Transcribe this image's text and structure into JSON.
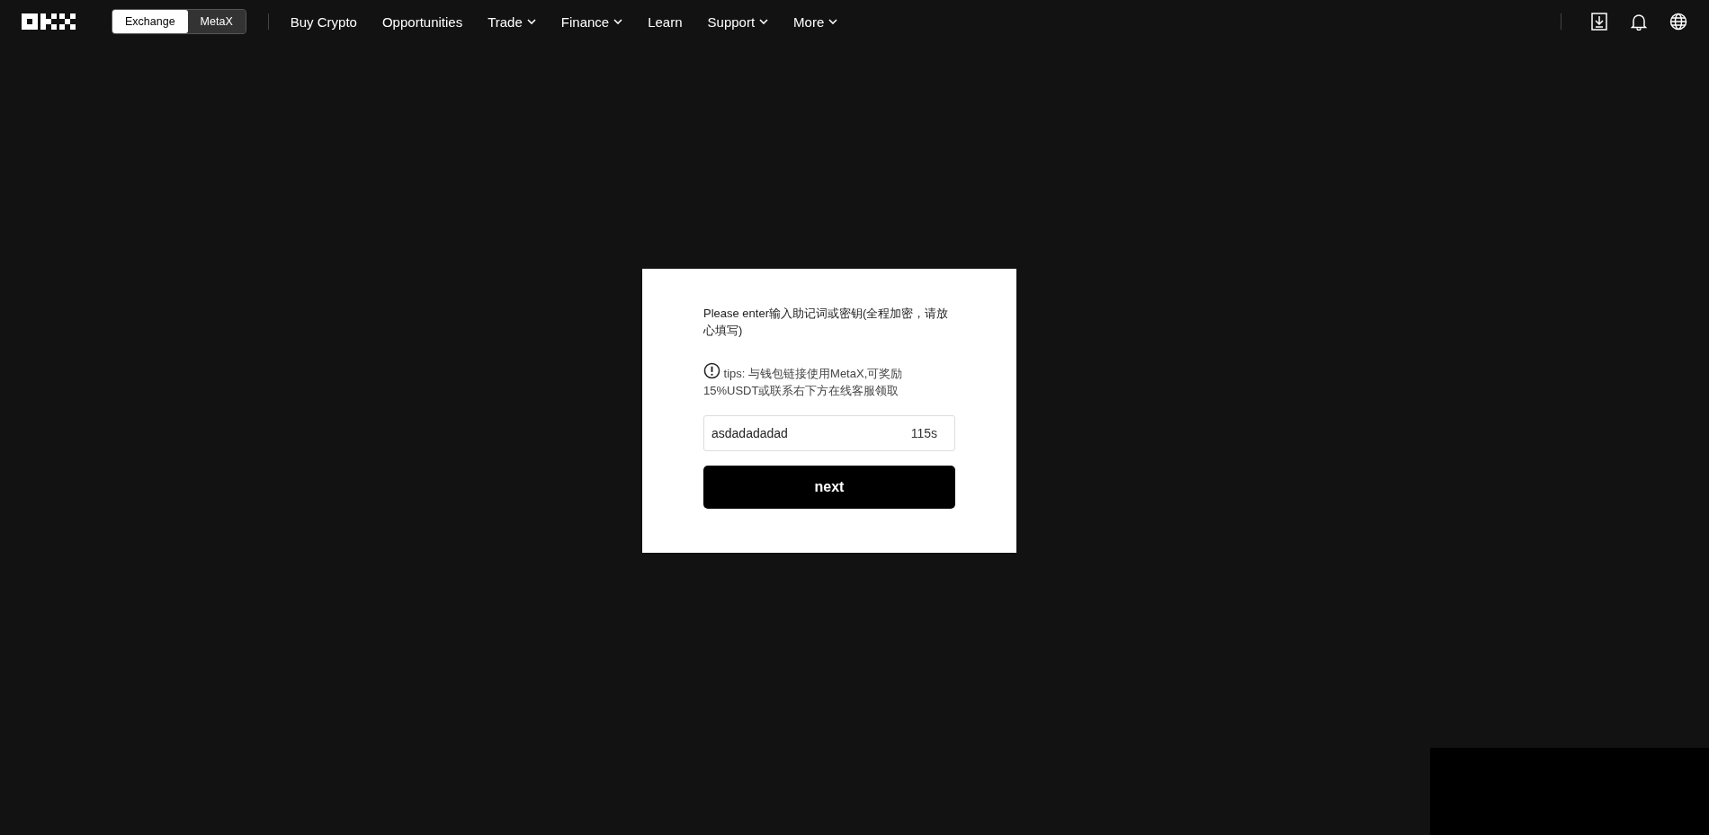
{
  "header": {
    "mode_tabs": [
      {
        "label": "Exchange",
        "selected": true
      },
      {
        "label": "MetaX",
        "selected": false
      }
    ],
    "nav": [
      {
        "label": "Buy Crypto",
        "dropdown": false
      },
      {
        "label": "Opportunities",
        "dropdown": false
      },
      {
        "label": "Trade",
        "dropdown": true
      },
      {
        "label": "Finance",
        "dropdown": true
      },
      {
        "label": "Learn",
        "dropdown": false
      },
      {
        "label": "Support",
        "dropdown": true
      },
      {
        "label": "More",
        "dropdown": true
      }
    ]
  },
  "dialog": {
    "prompt": "Please enter输入助记词或密钥(全程加密，请放心填写)",
    "tips": "tips: 与钱包链接使用MetaX,可奖励15%USDT或联系右下方在线客服领取",
    "input_value": "asdadadadad",
    "countdown": "115s",
    "button": "next"
  }
}
